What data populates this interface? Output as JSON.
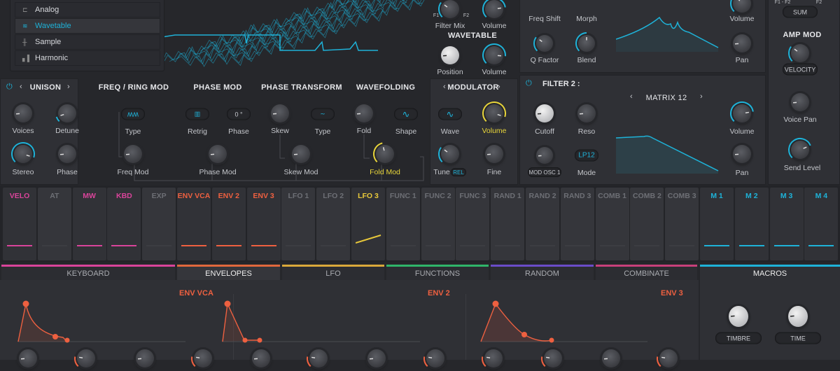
{
  "osc_menu": {
    "items": [
      {
        "label": "Analog",
        "icon": "analog-icon"
      },
      {
        "label": "Wavetable",
        "icon": "wavetable-icon",
        "selected": true
      },
      {
        "label": "Sample",
        "icon": "sample-icon"
      },
      {
        "label": "Harmonic",
        "icon": "harmonic-icon"
      }
    ]
  },
  "osc_mix": {
    "filter_mix": "Filter Mix",
    "f1": "F1",
    "f2": "F2",
    "volume": "Volume",
    "section": "WAVETABLE",
    "position": "Position",
    "volume2": "Volume"
  },
  "filter1": {
    "freq_shift": "Freq Shift",
    "morph": "Morph",
    "q_factor": "Q Factor",
    "blend": "Blend",
    "volume": "Volume",
    "pan": "Pan"
  },
  "right": {
    "f1f2": "F1 - F2",
    "f2": "F2",
    "sum": "SUM",
    "amp_mod": "AMP MOD",
    "velocity": "VELOCITY",
    "voice_pan": "Voice Pan",
    "send_level": "Send Level"
  },
  "unison": {
    "title": "UNISON",
    "voices": "Voices",
    "detune": "Detune",
    "stereo": "Stereo",
    "phase": "Phase"
  },
  "freq_ring": {
    "title": "FREQ / RING MOD",
    "type": "Type",
    "freq_mod": "Freq Mod"
  },
  "phase_mod": {
    "title": "PHASE MOD",
    "retrig": "Retrig",
    "phase_value": "0 °",
    "phase": "Phase",
    "phase_mod": "Phase Mod"
  },
  "phase_transform": {
    "title": "PHASE TRANSFORM",
    "skew": "Skew",
    "type": "Type",
    "skew_mod": "Skew Mod"
  },
  "wavefolding": {
    "title": "WAVEFOLDING",
    "fold": "Fold",
    "shape": "Shape",
    "fold_mod": "Fold Mod"
  },
  "modulator": {
    "title": "MODULATOR",
    "wave": "Wave",
    "volume": "Volume",
    "tune": "Tune",
    "rel": "REL",
    "fine": "Fine"
  },
  "filter2": {
    "title": "FILTER 2 :",
    "type": "MATRIX 12",
    "cutoff": "Cutoff",
    "reso": "Reso",
    "mod_src": "MOD OSC 1",
    "mode_value": "LP12",
    "mode": "Mode",
    "volume": "Volume",
    "pan": "Pan"
  },
  "mod_sources": [
    {
      "label": "VELO",
      "color": "#d9449a",
      "active": true
    },
    {
      "label": "AT",
      "color": "#6d6f75"
    },
    {
      "label": "MW",
      "color": "#d9449a",
      "active": true
    },
    {
      "label": "KBD",
      "color": "#d9449a",
      "active": true
    },
    {
      "label": "EXP",
      "color": "#6d6f75"
    },
    {
      "label": "ENV VCA",
      "color": "#ee6040",
      "active": true
    },
    {
      "label": "ENV 2",
      "color": "#ee6040",
      "active": true
    },
    {
      "label": "ENV 3",
      "color": "#ee6040",
      "active": true
    },
    {
      "label": "LFO 1",
      "color": "#6d6f75"
    },
    {
      "label": "LFO 2",
      "color": "#6d6f75"
    },
    {
      "label": "LFO 3",
      "color": "#e8c83a",
      "active": true
    },
    {
      "label": "FUNC 1",
      "color": "#6d6f75"
    },
    {
      "label": "FUNC 2",
      "color": "#6d6f75"
    },
    {
      "label": "FUNC 3",
      "color": "#6d6f75"
    },
    {
      "label": "RAND 1",
      "color": "#6d6f75"
    },
    {
      "label": "RAND 2",
      "color": "#6d6f75"
    },
    {
      "label": "RAND 3",
      "color": "#6d6f75"
    },
    {
      "label": "COMB 1",
      "color": "#6d6f75"
    },
    {
      "label": "COMB 2",
      "color": "#6d6f75"
    },
    {
      "label": "COMB 3",
      "color": "#6d6f75"
    },
    {
      "label": "M 1",
      "color": "#1eb2d8",
      "active": true
    },
    {
      "label": "M 2",
      "color": "#1eb2d8",
      "active": true
    },
    {
      "label": "M 3",
      "color": "#1eb2d8",
      "active": true
    },
    {
      "label": "M 4",
      "color": "#1eb2d8",
      "active": true
    }
  ],
  "tabs": [
    {
      "label": "KEYBOARD",
      "color": "#d9449a"
    },
    {
      "label": "ENVELOPES",
      "color": "#e0683c",
      "active": true
    },
    {
      "label": "LFO",
      "color": "#d9a83a"
    },
    {
      "label": "FUNCTIONS",
      "color": "#2fb56a"
    },
    {
      "label": "RANDOM",
      "color": "#6a4cc8"
    },
    {
      "label": "COMBINATE",
      "color": "#c8407a"
    },
    {
      "label": "MACROS",
      "color": "#1eb2d8"
    }
  ],
  "envelopes": [
    {
      "label": "ENV VCA"
    },
    {
      "label": "ENV 2"
    },
    {
      "label": "ENV 3"
    }
  ],
  "macros": {
    "timbre": "TIMBRE",
    "time": "TIME"
  },
  "colors": {
    "accent": "#1eb2d8",
    "highlight": "#e8d53a",
    "envelope": "#ee6040"
  }
}
